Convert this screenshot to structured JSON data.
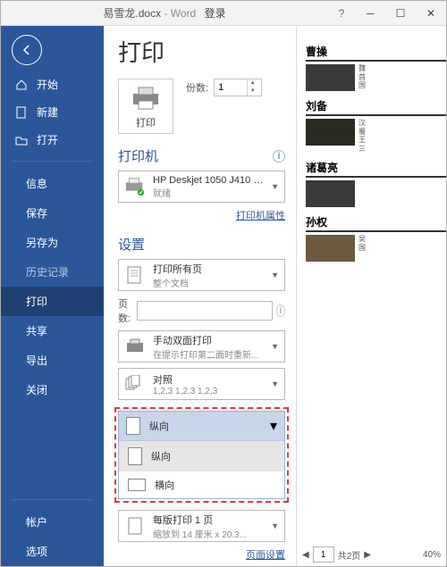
{
  "titlebar": {
    "filename": "易雪龙.docx",
    "sep": "-",
    "app": "Word",
    "login": "登录"
  },
  "sidebar": {
    "home": "开始",
    "new": "新建",
    "open": "打开",
    "info": "信息",
    "save": "保存",
    "saveas": "另存为",
    "history": "历史记录",
    "print": "打印",
    "share": "共享",
    "export": "导出",
    "close": "关闭",
    "account": "帐户",
    "options": "选项"
  },
  "print": {
    "heading": "打印",
    "button_label": "打印",
    "copies_label": "份数:",
    "copies_value": "1"
  },
  "printer": {
    "section": "打印机",
    "name": "HP Deskjet 1050 J410 s...",
    "status": "就绪",
    "props_link": "打印机属性"
  },
  "settings": {
    "section": "设置",
    "range_l1": "打印所有页",
    "range_l2": "整个文档",
    "pages_label": "页数:",
    "duplex_l1": "手动双面打印",
    "duplex_l2": "在提示打印第二面时重新...",
    "collate_l1": "对照",
    "collate_l2": "1,2,3   1,2,3   1,2,3",
    "orient_selected": "纵向",
    "orient_portrait": "纵向",
    "orient_landscape": "横向",
    "pps_l1": "每版打印 1 页",
    "pps_l2": "缩放到 14 厘米 x 20.3...",
    "page_setup_link": "页面设置"
  },
  "preview": {
    "names": [
      "曹操",
      "刘备",
      "诸葛亮",
      "孙权"
    ]
  },
  "footer": {
    "page_current": "1",
    "page_total_label": "共2页",
    "zoom": "40%"
  }
}
